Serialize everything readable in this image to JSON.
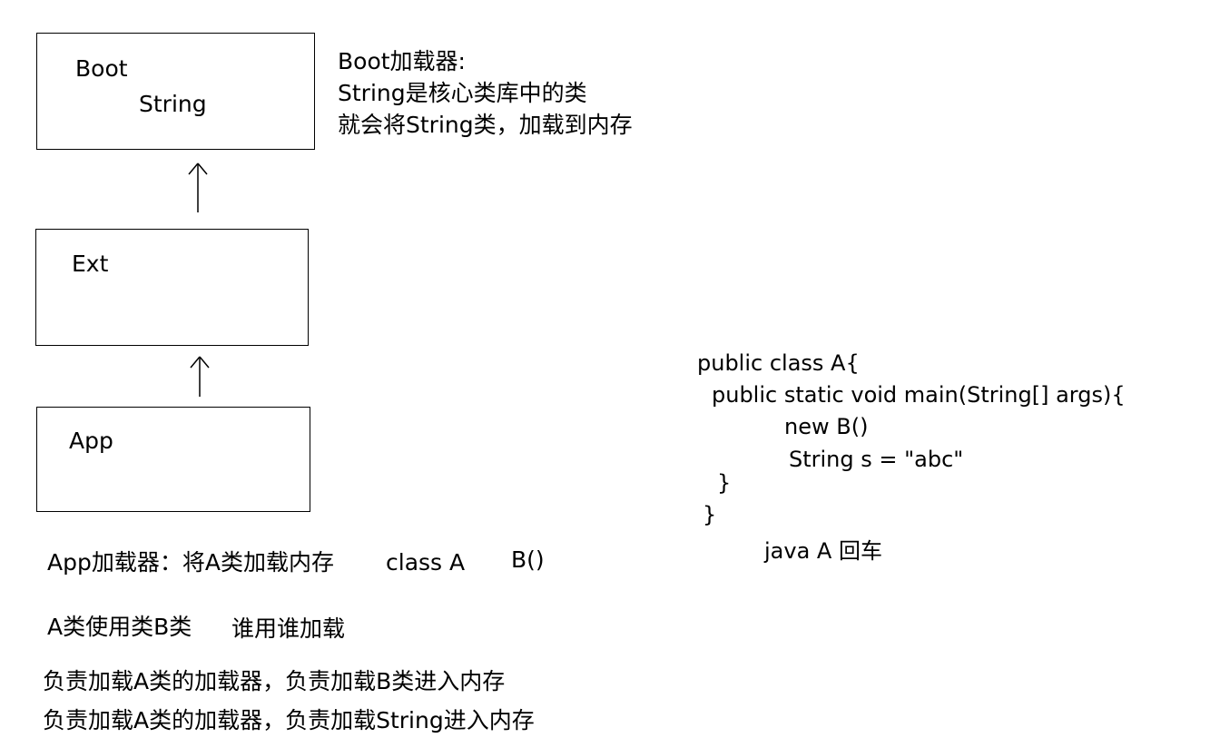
{
  "loaders": {
    "boot": {
      "label": "Boot",
      "class_name": "String"
    },
    "ext": {
      "label": "Ext"
    },
    "app": {
      "label": "App"
    }
  },
  "boot_note": {
    "line1": "Boot加载器:",
    "line2": "String是核心类库中的类",
    "line3": "就会将String类，加载到内存"
  },
  "app_note": {
    "text": "App加载器：将A类加载内存",
    "class_a": "class A",
    "b_call": "B()"
  },
  "usage_note": {
    "text": "A类使用类B类",
    "rule": "谁用谁加载"
  },
  "responsibility": {
    "line1": "负责加载A类的加载器，负责加载B类进入内存",
    "line2": "负责加载A类的加载器，负责加载String进入内存"
  },
  "code": {
    "line1": "public class A{",
    "line2": "public static void main(String[] args){",
    "line3": "new B()",
    "line4": "String s = \"abc\"",
    "line5": "}",
    "line6": "}",
    "command": "java A 回车"
  }
}
